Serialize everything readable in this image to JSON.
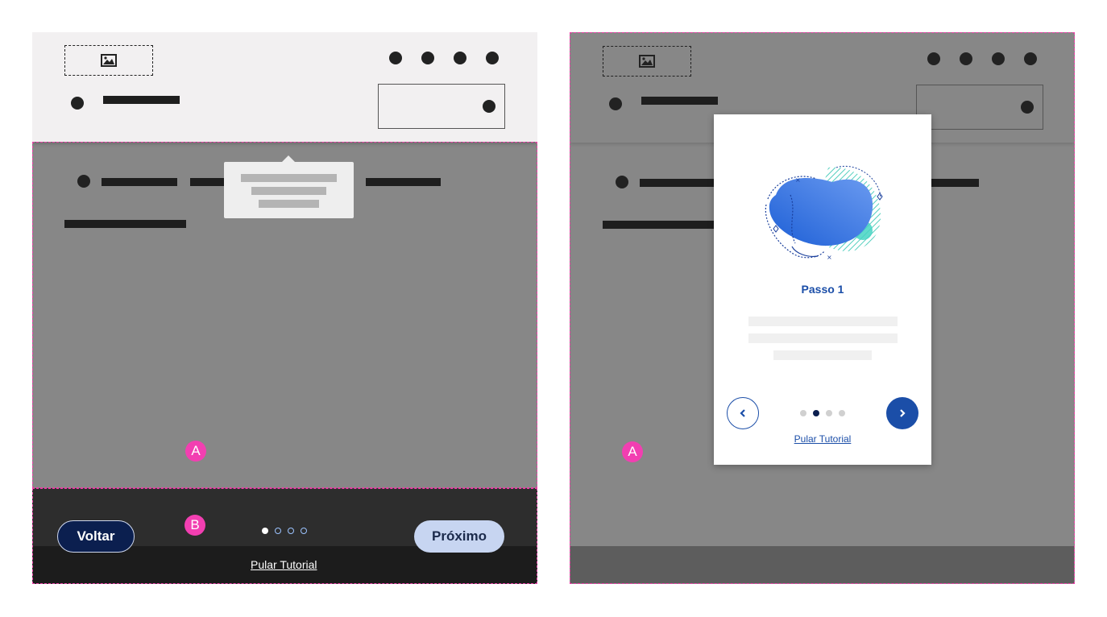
{
  "left_panel": {
    "badge_a": "A",
    "badge_b": "B",
    "footer": {
      "back_label": "Voltar",
      "next_label": "Próximo",
      "skip_label": "Pular Tutorial",
      "pagination": {
        "count": 4,
        "active": 1
      }
    }
  },
  "right_panel": {
    "badge_a": "A",
    "modal": {
      "title": "Passo 1",
      "skip_label": "Pular Tutorial",
      "prev_icon": "chevron-left-icon",
      "next_icon": "chevron-right-icon",
      "pagination": {
        "count": 4,
        "active": 2
      }
    }
  },
  "colors": {
    "accent": "#1b4ea8",
    "dark_button": "#0b1f4f",
    "light_button": "#c7d5f1",
    "annotation": "#f23fb1"
  }
}
